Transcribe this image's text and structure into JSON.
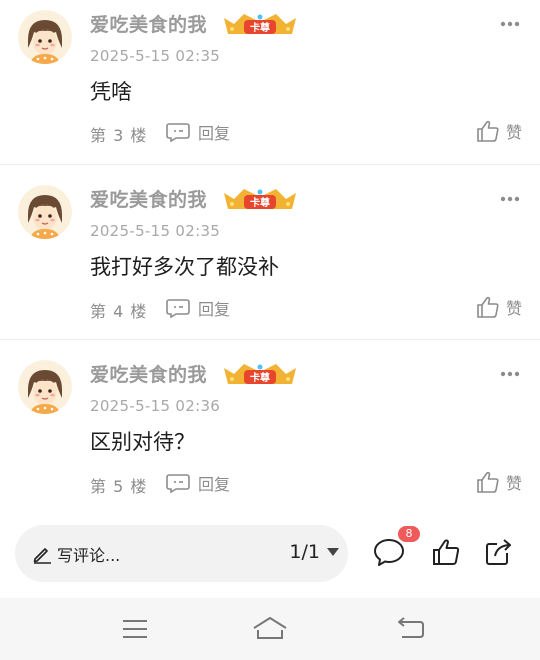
{
  "comments": [
    {
      "username": "爱吃美食的我",
      "badge_text": "卡尊",
      "timestamp": "2025-5-15 02:35",
      "content": "凭啥",
      "floor": "第 3 楼",
      "reply_label": "回复",
      "like_label": "赞"
    },
    {
      "username": "爱吃美食的我",
      "badge_text": "卡尊",
      "timestamp": "2025-5-15 02:35",
      "content": "我打好多次了都没补",
      "floor": "第 4 楼",
      "reply_label": "回复",
      "like_label": "赞"
    },
    {
      "username": "爱吃美食的我",
      "badge_text": "卡尊",
      "timestamp": "2025-5-15 02:36",
      "content": "区别对待？",
      "floor": "第 5 楼",
      "reply_label": "回复",
      "like_label": "赞"
    }
  ],
  "bottom_bar": {
    "input_placeholder": "写评论...",
    "page_indicator": "1/1",
    "comment_badge_count": "8"
  },
  "colors": {
    "badge_red": "#ef5a5a",
    "text_gray": "#8c8c8c",
    "badge_gold": "#f2b233"
  }
}
